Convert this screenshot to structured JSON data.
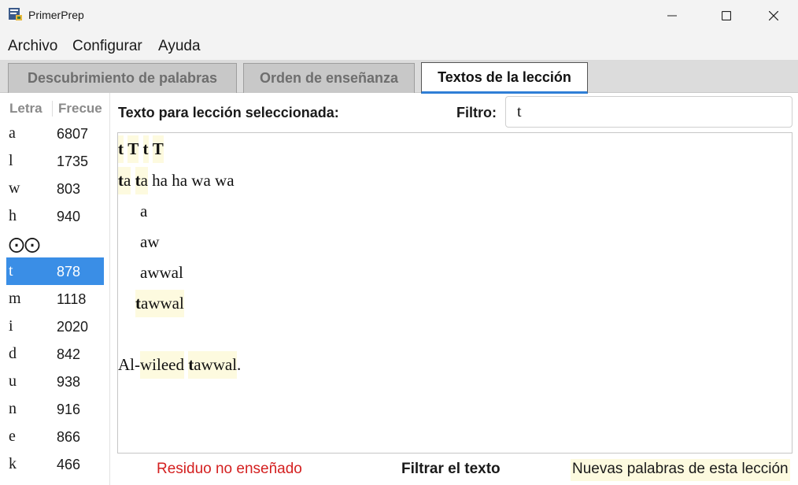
{
  "window": {
    "title": "PrimerPrep",
    "minimize_icon": "minimize-icon",
    "maximize_icon": "maximize-icon",
    "close_icon": "close-icon"
  },
  "menu": {
    "items": [
      "Archivo",
      "Configurar",
      "Ayuda"
    ]
  },
  "tabs": [
    {
      "label": "Descubrimiento de palabras",
      "active": false
    },
    {
      "label": "Orden de enseñanza",
      "active": false
    },
    {
      "label": "Textos de la lección",
      "active": true
    }
  ],
  "letter_list": {
    "headers": [
      "Letra",
      "Frecue"
    ],
    "rows": [
      {
        "letter": "a",
        "freq": "6807"
      },
      {
        "letter": "l",
        "freq": "1735"
      },
      {
        "letter": "w",
        "freq": "803"
      },
      {
        "letter": "h",
        "freq": "940"
      },
      {
        "letter": "⨀⨀",
        "freq": ""
      },
      {
        "letter": "t",
        "freq": "878"
      },
      {
        "letter": "m",
        "freq": "1118"
      },
      {
        "letter": "i",
        "freq": "2020"
      },
      {
        "letter": "d",
        "freq": "842"
      },
      {
        "letter": "u",
        "freq": "938"
      },
      {
        "letter": "n",
        "freq": "916"
      },
      {
        "letter": "e",
        "freq": "866"
      },
      {
        "letter": "k",
        "freq": "466"
      }
    ],
    "selected_letter": "t",
    "selected_color": "#3a8ee6"
  },
  "lesson": {
    "label": "Texto para lección seleccionada:",
    "filter_label": "Filtro:",
    "filter_value": "t",
    "text_lines": {
      "l1": {
        "w1": "t",
        "w2": "T",
        "w3": "t",
        "w4": "T"
      },
      "l2": {
        "w1b": "t",
        "w1r": "a",
        "w2b": "t",
        "w2r": "a",
        "rest": "ha ha wa wa"
      },
      "l3": "a",
      "l4": "aw",
      "l5": "awwal",
      "l6": {
        "b": "t",
        "r": "awwal"
      },
      "l7": {
        "pre": "Al-",
        "w1": "wileed",
        "sp": " ",
        "w2b": "t",
        "w2r": "awwal",
        "post": "."
      }
    },
    "highlight_color": "#fdfadf"
  },
  "legend": {
    "residue": "Residuo no enseñado",
    "residue_color": "#d42020",
    "filter": "Filtrar el texto",
    "new_words": "Nuevas palabras de esta lección"
  }
}
